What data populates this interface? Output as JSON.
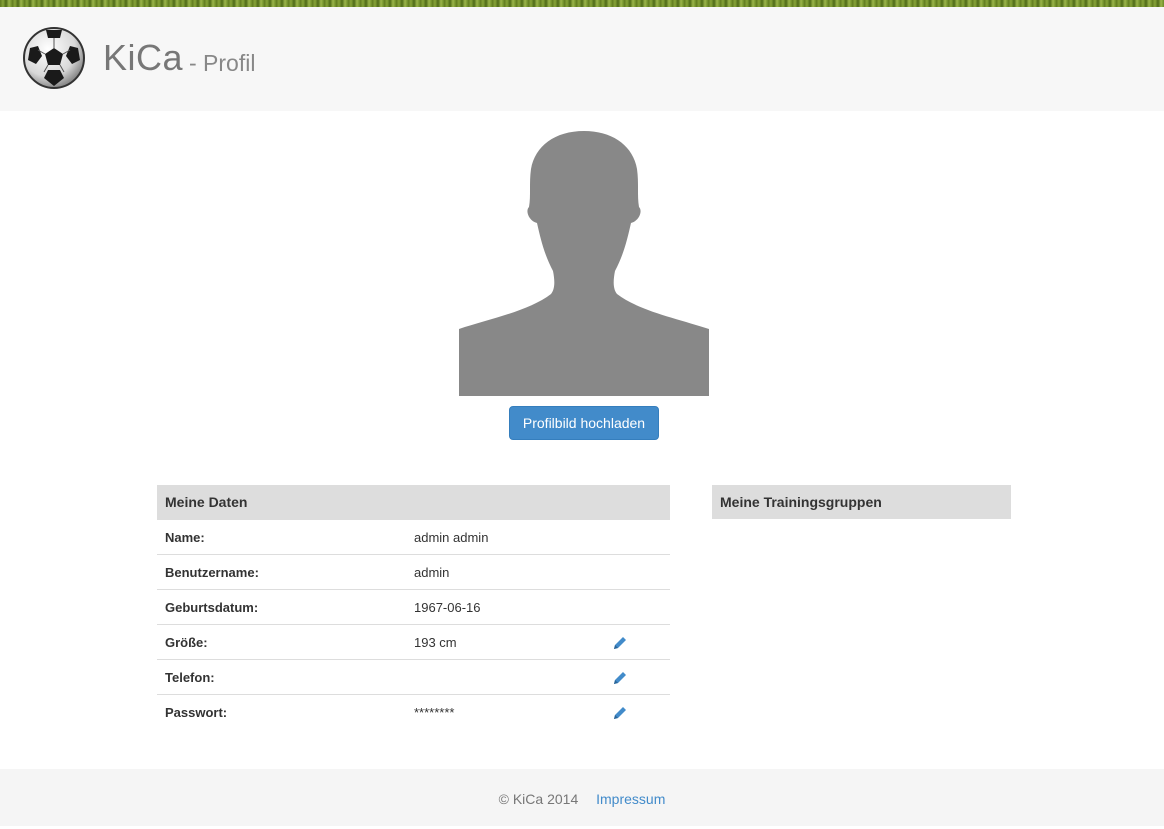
{
  "header": {
    "brand": "KiCa",
    "subtitle": "- Profil",
    "logo_icon": "soccer-ball-icon"
  },
  "profile": {
    "avatar_icon": "person-silhouette-icon",
    "upload_label": "Profilbild hochladen"
  },
  "my_data": {
    "title": "Meine Daten",
    "rows": [
      {
        "label": "Name:",
        "value": "admin admin",
        "editable": false
      },
      {
        "label": "Benutzername:",
        "value": "admin",
        "editable": false
      },
      {
        "label": "Geburtsdatum:",
        "value": "1967-06-16",
        "editable": false
      },
      {
        "label": "Größe:",
        "value": "193 cm",
        "editable": true
      },
      {
        "label": "Telefon:",
        "value": "",
        "editable": true
      },
      {
        "label": "Passwort:",
        "value": "********",
        "editable": true
      }
    ],
    "edit_icon": "pencil-icon"
  },
  "training_groups": {
    "title": "Meine Trainingsgruppen"
  },
  "footer": {
    "copyright": "© KiCa 2014",
    "impressum": "Impressum"
  },
  "colors": {
    "primary": "#428bca",
    "panel_header": "#dddddd",
    "avatar": "#888888"
  }
}
